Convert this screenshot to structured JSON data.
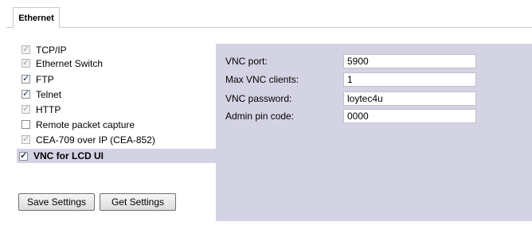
{
  "tabs": [
    {
      "label": "Ethernet",
      "active": true
    }
  ],
  "services": [
    {
      "label": "TCP/IP",
      "checked": true,
      "disabled": true
    },
    {
      "label": "Ethernet Switch",
      "checked": true,
      "disabled": true
    },
    {
      "label": "FTP",
      "checked": true,
      "disabled": false
    },
    {
      "label": "Telnet",
      "checked": true,
      "disabled": false
    },
    {
      "label": "HTTP",
      "checked": true,
      "disabled": true
    },
    {
      "label": "Remote packet capture",
      "checked": false,
      "disabled": false
    },
    {
      "label": "CEA-709 over IP (CEA-852)",
      "checked": true,
      "disabled": true
    },
    {
      "label": "VNC for LCD UI",
      "checked": true,
      "disabled": false,
      "selected": true
    }
  ],
  "buttons": {
    "save": "Save Settings",
    "get": "Get Settings"
  },
  "vnc": {
    "port_label": "VNC port:",
    "port_value": "5900",
    "clients_label": "Max VNC clients:",
    "clients_value": "1",
    "password_label": "VNC password:",
    "password_value": "loytec4u",
    "pin_label": "Admin pin code:",
    "pin_value": "0000"
  },
  "colors": {
    "panel": "#d4d3e4",
    "border": "#c8c8d4"
  }
}
